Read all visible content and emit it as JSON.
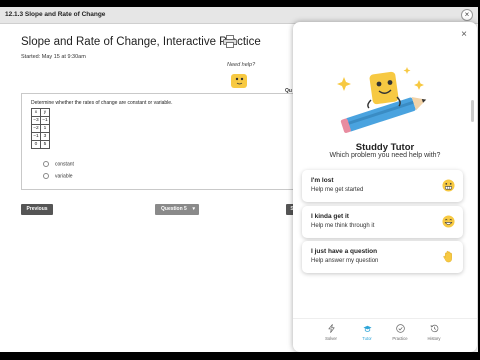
{
  "window": {
    "title": "12.1.3 Slope and Rate of Change",
    "close_glyph": "×"
  },
  "page": {
    "title": "Slope and Rate of Change, Interactive Practice",
    "started": "Started: May 15 at 9:30am",
    "need_help": "Need help?",
    "question_header": "Qu"
  },
  "question": {
    "instruction": "Determine whether the rates of change are constant or variable.",
    "table_header": [
      "x",
      "y"
    ],
    "table_rows": [
      [
        "−3",
        "−1"
      ],
      [
        "−2",
        "1"
      ],
      [
        "−1",
        "3"
      ],
      [
        "0",
        "5"
      ]
    ],
    "options": [
      "constant",
      "variable"
    ]
  },
  "footer": {
    "previous": "Previous",
    "question_select": "Question 5",
    "next_partial": "S"
  },
  "tutor": {
    "close_glyph": "×",
    "name": "Studdy Tutor",
    "subtitle": "Which problem you need help with?",
    "options": [
      {
        "title": "I'm lost",
        "subtitle": "Help me get started",
        "icon": "grimace-emoji-icon"
      },
      {
        "title": "I kinda get it",
        "subtitle": "Help me think through it",
        "icon": "grin-emoji-icon"
      },
      {
        "title": "I just have a question",
        "subtitle": "Help answer my question",
        "icon": "raised-hand-emoji-icon"
      }
    ],
    "nav": [
      {
        "label": "Solver",
        "icon": "bolt-icon",
        "active": false
      },
      {
        "label": "Tutor",
        "icon": "graduation-cap-icon",
        "active": true
      },
      {
        "label": "Practice",
        "icon": "check-circle-icon",
        "active": false
      },
      {
        "label": "History",
        "icon": "history-icon",
        "active": false
      }
    ]
  },
  "colors": {
    "accent": "#2ea5d8",
    "mascot": "#f7c942",
    "pencil": "#4aa3df"
  }
}
